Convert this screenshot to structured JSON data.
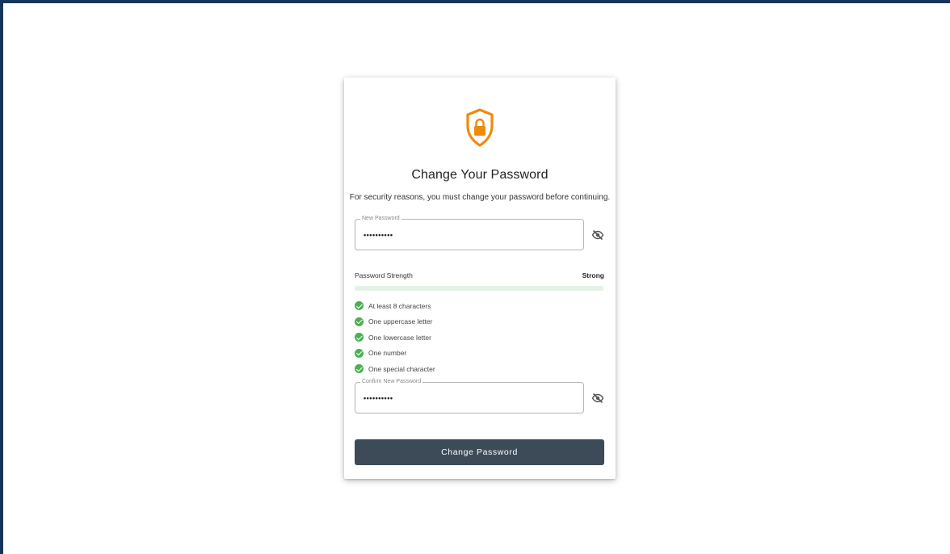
{
  "card": {
    "title": "Change Your Password",
    "subtitle": "For security reasons, you must change your password before continuing."
  },
  "new_password": {
    "label": "New Password",
    "value": "••••••••••",
    "visibility_icon": "eye-off-icon"
  },
  "strength": {
    "label": "Password Strength",
    "value": "Strong",
    "level_percent": 100
  },
  "requirements": [
    {
      "label": "At least 8 characters",
      "met": true
    },
    {
      "label": "One uppercase letter",
      "met": true
    },
    {
      "label": "One lowercase letter",
      "met": true
    },
    {
      "label": "One number",
      "met": true
    },
    {
      "label": "One special character",
      "met": true
    }
  ],
  "confirm_password": {
    "label": "Confirm New Password",
    "value": "••••••••••",
    "visibility_icon": "eye-off-icon"
  },
  "submit_label": "Change Password",
  "colors": {
    "page_border": "#15365a",
    "accent_shield": "#f08a0c",
    "success": "#4caf50",
    "button": "#3d4b58"
  }
}
